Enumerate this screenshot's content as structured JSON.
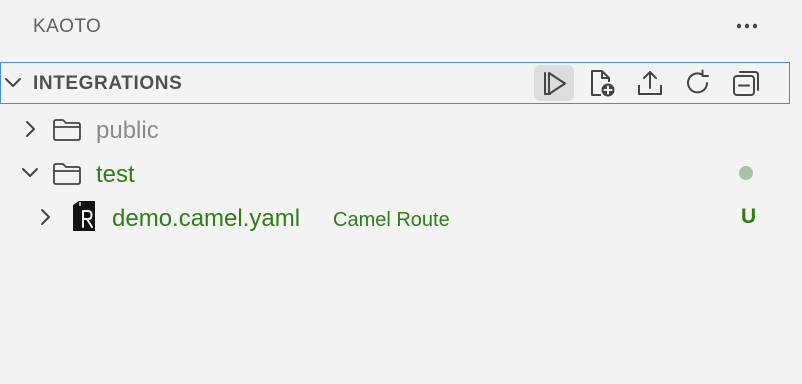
{
  "colors": {
    "background": "#f3f3f3",
    "focus_border": "#4a8ad8",
    "muted_text": "#8a8a8a",
    "git_untracked": "#2e7d16",
    "modified_dot": "#a7c3a0",
    "icon": "#444444"
  },
  "panel": {
    "title": "KAOTO",
    "more_icon": "ellipsis-icon"
  },
  "section": {
    "title": "INTEGRATIONS",
    "expanded": true,
    "actions": [
      {
        "icon": "run-icon",
        "active": true
      },
      {
        "icon": "new-file-icon",
        "active": false
      },
      {
        "icon": "export-icon",
        "active": false
      },
      {
        "icon": "refresh-icon",
        "active": false
      },
      {
        "icon": "collapse-all-icon",
        "active": false
      }
    ]
  },
  "tree": {
    "public": {
      "label": "public",
      "expanded": false
    },
    "test": {
      "label": "test",
      "expanded": true
    },
    "demo": {
      "label": "demo.camel.yaml",
      "description": "Camel Route",
      "status": "U",
      "expanded": false
    }
  }
}
